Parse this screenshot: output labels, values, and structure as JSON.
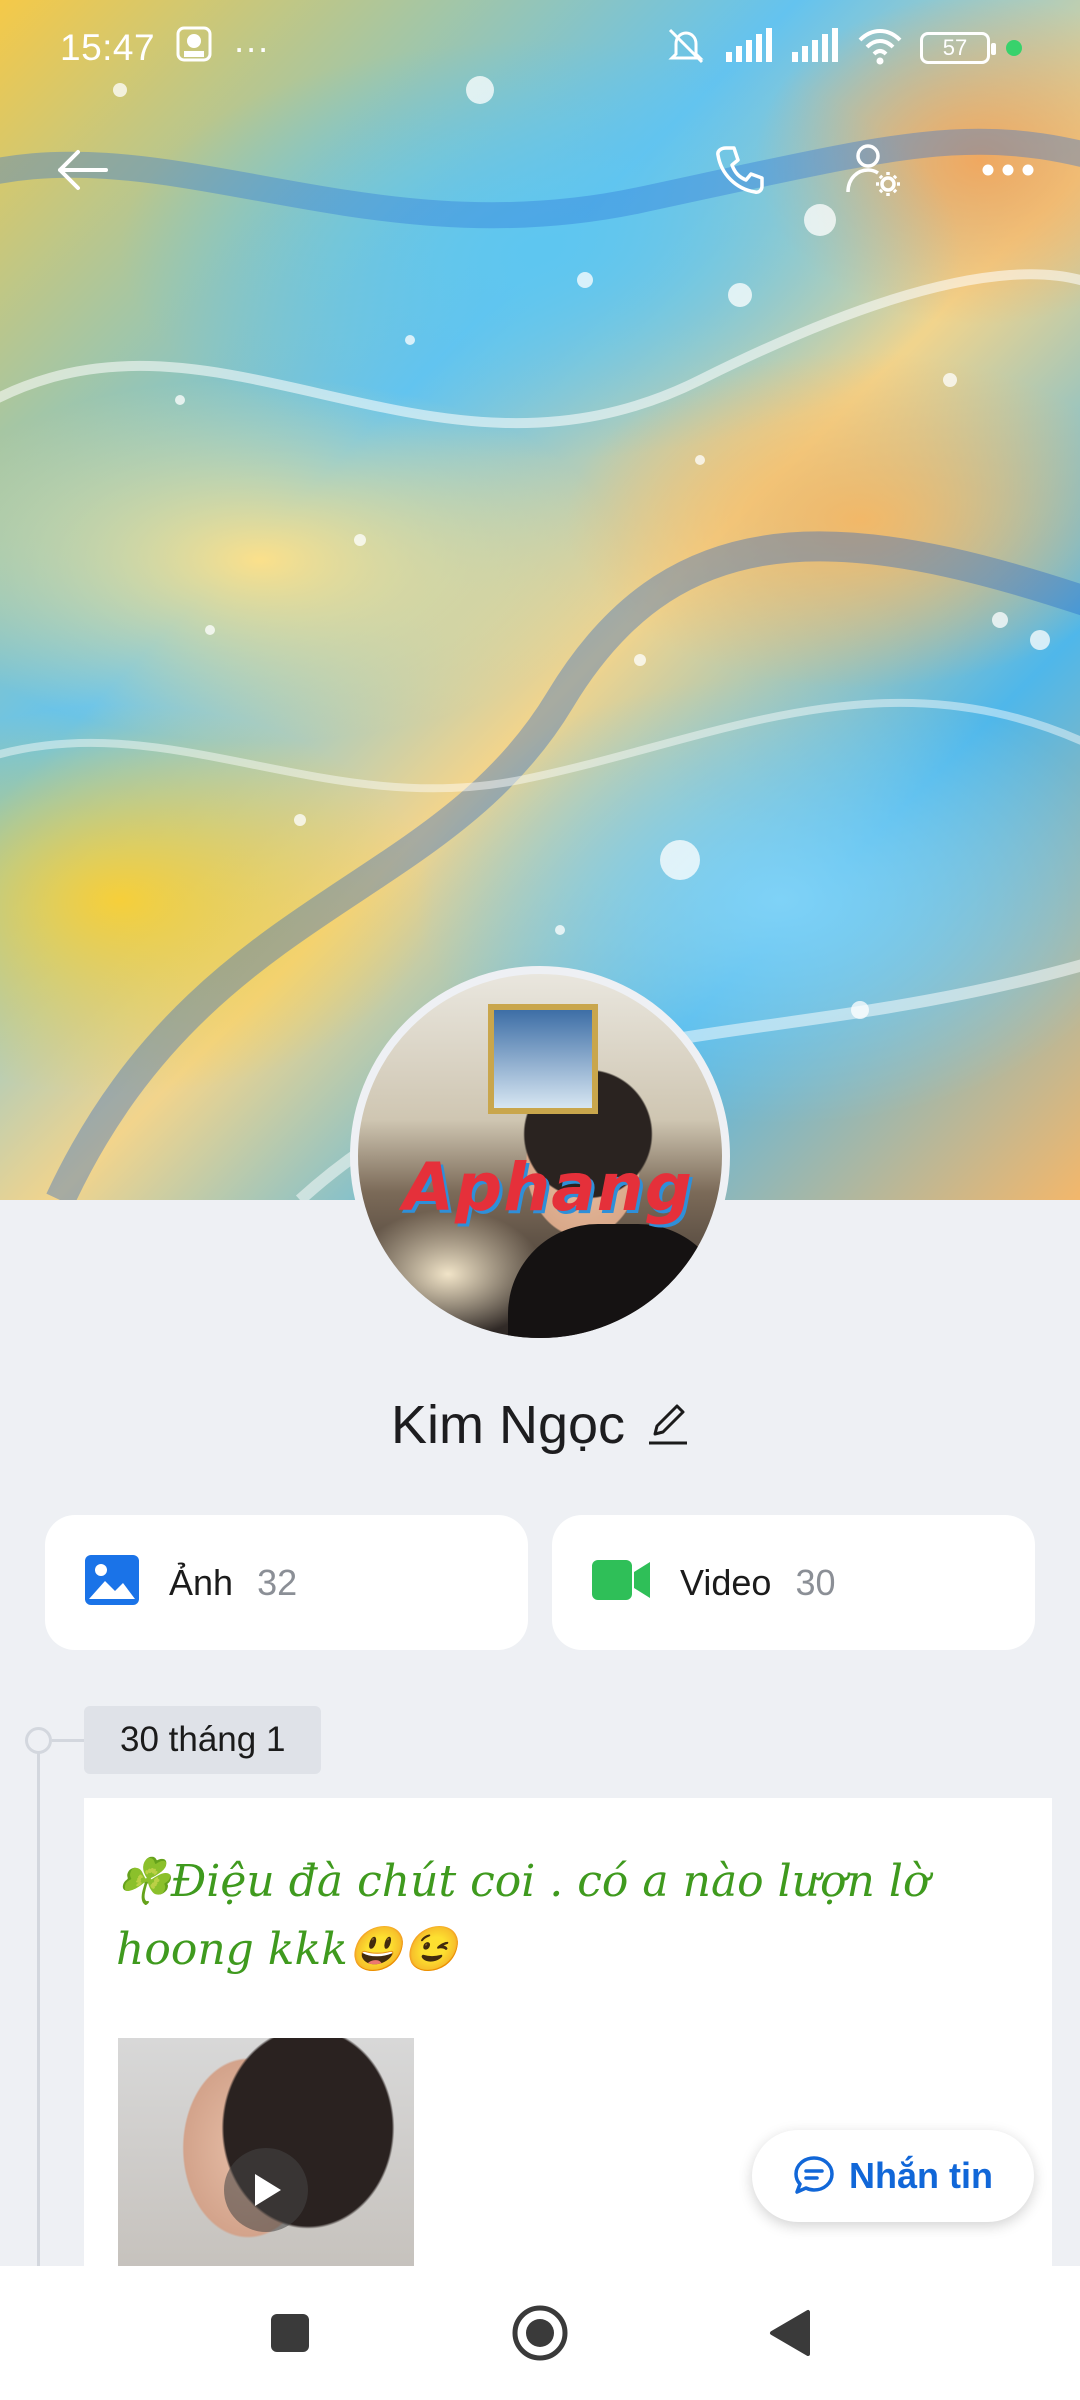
{
  "status_bar": {
    "time": "15:47",
    "dots": "···",
    "battery": "57"
  },
  "profile": {
    "name": "Kim Ngọc",
    "avatar_watermark": "Aphang"
  },
  "media": [
    {
      "label": "Ảnh",
      "count": "32",
      "icon": "image-icon",
      "color": "#1a73e8"
    },
    {
      "label": "Video",
      "count": "30",
      "icon": "video-camera-icon",
      "color": "#2fbf58"
    }
  ],
  "timeline": {
    "date_label": "30 tháng 1"
  },
  "post": {
    "text": "☘️Điệu đà chút coi . có a  nào lượn lờ hoong kkk😃😉"
  },
  "fab": {
    "label": "Nhắn tin"
  },
  "colors": {
    "accent": "#1167d8",
    "post_text": "#3f9a1e",
    "background": "#eef0f4"
  }
}
